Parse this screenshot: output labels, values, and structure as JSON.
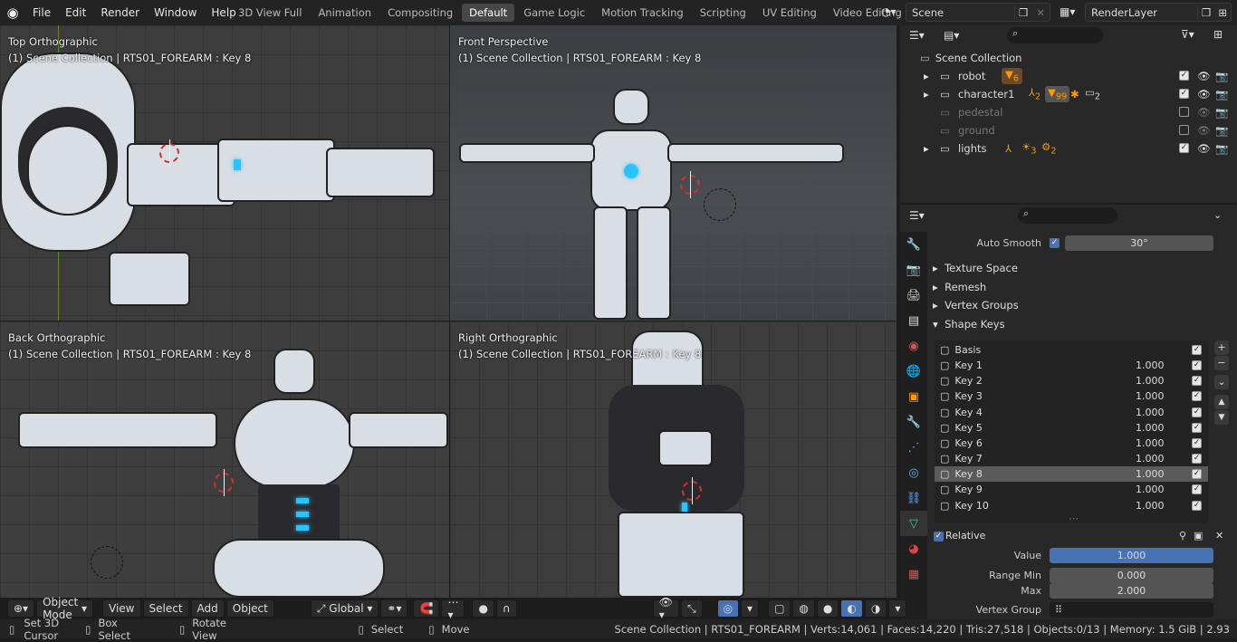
{
  "menu": {
    "items": [
      "File",
      "Edit",
      "Render",
      "Window",
      "Help"
    ]
  },
  "workspaces": [
    "3D View Full",
    "Animation",
    "Compositing",
    "Default",
    "Game Logic",
    "Motion Tracking",
    "Scripting",
    "UV Editing",
    "Video Editing"
  ],
  "active_workspace": "Default",
  "scene": {
    "name": "Scene",
    "render_layer": "RenderLayer"
  },
  "viewports": [
    {
      "title": "Top Orthographic",
      "subtitle": "(1) Scene Collection | RTS01_FOREARM : Key 8"
    },
    {
      "title": "Front Perspective",
      "subtitle": "(1) Scene Collection | RTS01_FOREARM : Key 8"
    },
    {
      "title": "Back Orthographic",
      "subtitle": "(1) Scene Collection | RTS01_FOREARM : Key 8"
    },
    {
      "title": "Right Orthographic",
      "subtitle": "(1) Scene Collection | RTS01_FOREARM : Key 8"
    }
  ],
  "viewport_header": {
    "mode": "Object Mode",
    "view": "View",
    "select": "Select",
    "add": "Add",
    "object": "Object",
    "orientation": "Global"
  },
  "outliner": {
    "root": "Scene Collection",
    "items": [
      {
        "name": "robot",
        "badge": "6",
        "visible": true
      },
      {
        "name": "character1",
        "badges": [
          "2",
          "99",
          "2"
        ],
        "visible": true
      },
      {
        "name": "pedestal",
        "visible": false
      },
      {
        "name": "ground",
        "visible": false
      },
      {
        "name": "lights",
        "badges": [
          "3",
          "2"
        ],
        "visible": true
      }
    ]
  },
  "properties": {
    "auto_smooth_label": "Auto Smooth",
    "auto_smooth_angle": "30°",
    "sections": [
      "Texture Space",
      "Remesh",
      "Vertex Groups",
      "Shape Keys"
    ],
    "shape_keys": [
      {
        "name": "Basis",
        "value": ""
      },
      {
        "name": "Key 1",
        "value": "1.000"
      },
      {
        "name": "Key 2",
        "value": "1.000"
      },
      {
        "name": "Key 3",
        "value": "1.000"
      },
      {
        "name": "Key 4",
        "value": "1.000"
      },
      {
        "name": "Key 5",
        "value": "1.000"
      },
      {
        "name": "Key 6",
        "value": "1.000"
      },
      {
        "name": "Key 7",
        "value": "1.000"
      },
      {
        "name": "Key 8",
        "value": "1.000"
      },
      {
        "name": "Key 9",
        "value": "1.000"
      },
      {
        "name": "Key 10",
        "value": "1.000"
      }
    ],
    "active_key": "Key 8",
    "relative_label": "Relative",
    "value_label": "Value",
    "value": "1.000",
    "range_min_label": "Range Min",
    "range_min": "0.000",
    "max_label": "Max",
    "max": "2.000",
    "vertex_group_label": "Vertex Group"
  },
  "status": {
    "set_cursor": "Set 3D Cursor",
    "box_select": "Box Select",
    "rotate_view": "Rotate View",
    "select": "Select",
    "move": "Move",
    "info": "Scene Collection | RTS01_FOREARM | Verts:14,061 | Faces:14,220 | Tris:27,518 | Objects:0/13 | Memory: 1.5 GiB | 2.93"
  },
  "colors": {
    "accent": "#4772b3",
    "cyan": "#29c4ff",
    "bg": "#1d1d1d"
  }
}
